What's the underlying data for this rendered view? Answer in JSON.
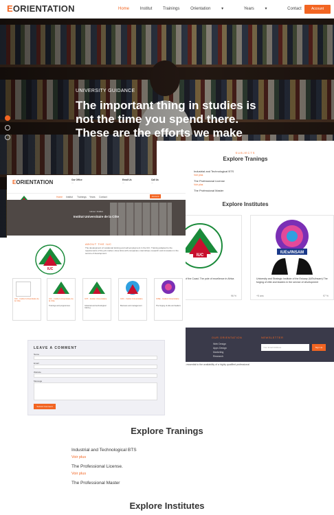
{
  "nav": {
    "logo_initial": "E",
    "logo_rest": "ORIENTATION",
    "links": [
      "Home",
      "Institut",
      "Trainings",
      "Orientation",
      "Years",
      "Contact"
    ],
    "account": "Account"
  },
  "hero": {
    "subtitle": "UNIVERSITY GUIDANCE",
    "title": "The important thing in studies is not the time you spend there. These are the efforts we make"
  },
  "overlay_right": {
    "subjects": "SUBJECTS",
    "trainings_title": "Explore Tranings",
    "items": [
      "Industrial and Technological BTS",
      "The Professional License",
      "The Professional Master"
    ],
    "see_plus": "Voir plus",
    "institutes_title": "Explore Institutes",
    "cards": [
      {
        "caption": "University Institute of the Coast. The pole of excellence in Africa",
        "count": "+5 ans",
        "pct": "96 %"
      },
      {
        "caption": "University and Strategic Institute of the Estuary (IUEs/Insam) The forging of elite and leaders in the service of development",
        "count": "+5 ans",
        "pct": "97 %"
      }
    ],
    "footer": {
      "h1": "OUR ORIENTATION",
      "h2": "NEWSLETTER",
      "links": [
        "Web Design",
        "Apps Design",
        "Marketing",
        "Research"
      ],
      "newsletter_placeholder": "Your Email Address",
      "signup": "Sign Up",
      "tagline": "is essential to the availability of a highly qualified professional"
    }
  },
  "overlay_left": {
    "logo_initial": "E",
    "logo_rest": "ORIENTATION",
    "info": [
      {
        "label": "Our Office",
        "value": "..."
      },
      {
        "label": "Email Us",
        "value": "..."
      },
      {
        "label": "Call Us",
        "value": "..."
      }
    ],
    "nav": [
      "Home",
      "Institut",
      "Trainings",
      "Years",
      "Contact"
    ],
    "account": "Account",
    "breadcrumb": "Home / Institut",
    "banner_title": "Institut Universitaire de la Côte",
    "about_heading": "ABOUT THE IUC",
    "about_text": "The development of vocational training and self-employment in the IUC. Training adapted to the requirements of the job market; close links with companies; internships; research and innovation in the service of development.",
    "thumbs": [
      {
        "caption": "IUC - Institut Universitaire de la Côte",
        "desc": "Trainings and programmes"
      },
      {
        "caption": "IUIT - Institut Universitaire",
        "desc": "Industrial and technological training"
      },
      {
        "caption": "IUIC - Institut Universitaire",
        "desc": "Business and management"
      },
      {
        "caption": "IUSE - Institut Universitaire",
        "desc": "The forging of elite and leaders"
      }
    ],
    "comment": {
      "heading": "LEAVE A COMMENT",
      "name": "Name",
      "email": "Email",
      "website": "Website",
      "message": "Message",
      "submit": "Submit Comment"
    }
  },
  "lower": {
    "subjects": "SUBJECTS",
    "trainings_title": "Explore Tranings",
    "items": [
      "Industrial and Technological BTS",
      "The Professional License.",
      "The Professional Master"
    ],
    "see_plus": "Voir plus",
    "institutes_title": "Explore Institutes"
  },
  "colors": {
    "accent": "#f26522",
    "footer": "#3a3a4a"
  }
}
